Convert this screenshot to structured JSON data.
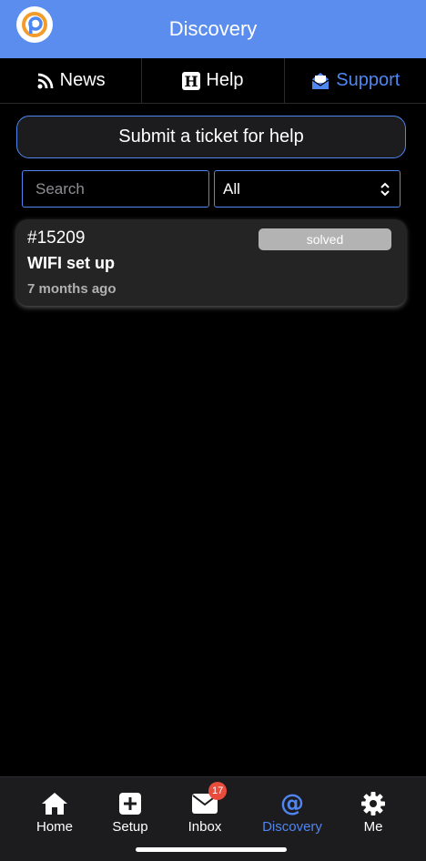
{
  "header": {
    "title": "Discovery"
  },
  "tabs": [
    {
      "label": "News",
      "icon": "rss-icon"
    },
    {
      "label": "Help",
      "icon": "h-square-icon"
    },
    {
      "label": "Support",
      "icon": "envelope-open-icon"
    }
  ],
  "submit_button": {
    "label": "Submit a ticket for help"
  },
  "filters": {
    "search_placeholder": "Search",
    "select_value": "All"
  },
  "tickets": [
    {
      "id": "#15209",
      "title": "WIFI set up",
      "time": "7 months ago",
      "status": "solved"
    }
  ],
  "bottom_nav": [
    {
      "label": "Home",
      "icon": "home-icon"
    },
    {
      "label": "Setup",
      "icon": "plus-square-icon"
    },
    {
      "label": "Inbox",
      "icon": "envelope-icon",
      "badge": "17"
    },
    {
      "label": "Discovery",
      "icon": "at-icon"
    },
    {
      "label": "Me",
      "icon": "gear-icon"
    }
  ],
  "colors": {
    "header": "#5b8def",
    "accent": "#4f86f0",
    "badge": "#e74c3c"
  }
}
